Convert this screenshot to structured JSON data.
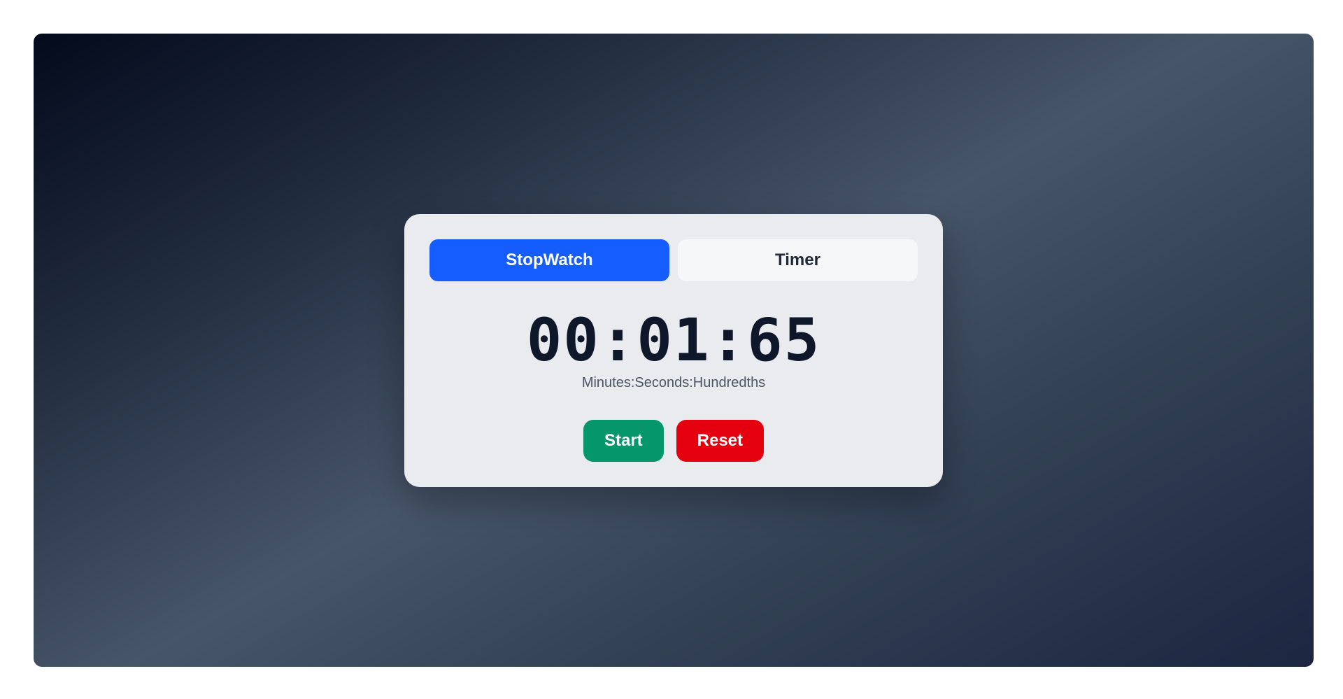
{
  "tabs": [
    {
      "label": "StopWatch",
      "active": true
    },
    {
      "label": "Timer",
      "active": false
    }
  ],
  "display": {
    "time": "00:01:65",
    "caption": "Minutes:Seconds:Hundredths"
  },
  "controls": {
    "start_label": "Start",
    "reset_label": "Reset"
  },
  "colors": {
    "accent": "#165dff",
    "start": "#059669",
    "reset": "#e4000f"
  }
}
